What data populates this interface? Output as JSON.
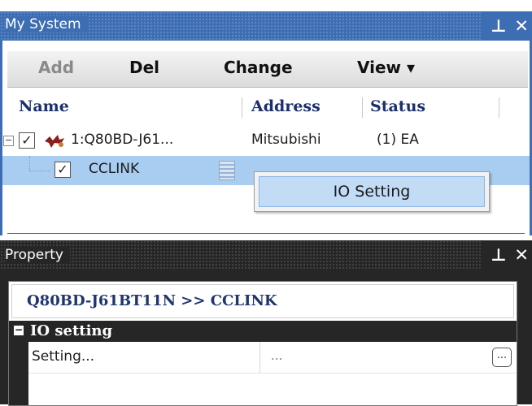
{
  "my_system": {
    "title": "My System",
    "pin_icon": "p",
    "close_icon": "×",
    "toolbar": {
      "add_label": "Add",
      "del_label": "Del",
      "change_label": "Change",
      "view_label": "View ▾"
    },
    "columns": {
      "name": "Name",
      "address": "Address",
      "status": "Status"
    },
    "tree": [
      {
        "name": "1:Q80BD-J61...",
        "address": "Mitsubishi",
        "status": "(1) EA",
        "checked": true,
        "expanded": true
      },
      {
        "name": "CCLINK",
        "checked": true,
        "selected": true
      }
    ],
    "context_menu": {
      "io_setting_label": "IO Setting"
    }
  },
  "property": {
    "title": "Property",
    "header": "Q80BD-J61BT11N >> CCLINK",
    "category": "IO setting",
    "rows": [
      {
        "name": "Setting...",
        "value": "...",
        "button_label": "..."
      }
    ]
  },
  "colors": {
    "titlebar_active": "#3d6db3",
    "titlebar_inactive": "#262626",
    "selection": "#a8cdf1",
    "header_text": "#1b2f6e"
  }
}
